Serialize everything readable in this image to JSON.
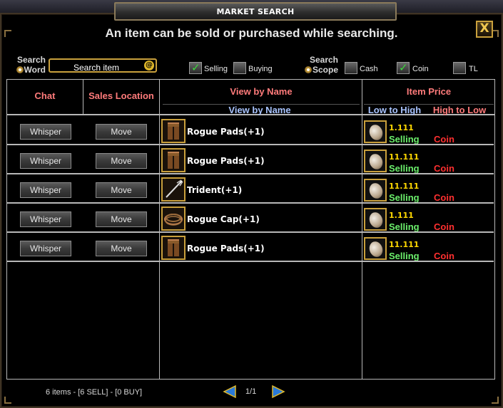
{
  "window": {
    "title": "MARKET SEARCH",
    "subtitle": "An item can be sold or purchased while searching.",
    "close_label": "X"
  },
  "search": {
    "word_label_1": "Search",
    "word_label_2": "Word",
    "placeholder": "Search item",
    "scope_label_1": "Search",
    "scope_label_2": "Scope"
  },
  "filters": {
    "selling": {
      "label": "Selling",
      "checked": true
    },
    "buying": {
      "label": "Buying",
      "checked": false
    },
    "cash": {
      "label": "Cash",
      "checked": false
    },
    "coin": {
      "label": "Coin",
      "checked": true
    },
    "tl": {
      "label": "TL",
      "checked": false
    }
  },
  "table": {
    "col_chat": "Chat",
    "col_sales_location": "Sales Location",
    "col_view_by_name": "View by Name",
    "col_view_by_name_sort": "View by Name",
    "col_item_price": "Item Price",
    "sort_low_high": "Low to High",
    "sort_high_low": "High to Low",
    "rows": [
      {
        "whisper": "Whisper",
        "move": "Move",
        "item": "Rogue Pads(+1)",
        "icon": "pads-icon",
        "price": "1.111",
        "status": "Selling",
        "currency": "Coin"
      },
      {
        "whisper": "Whisper",
        "move": "Move",
        "item": "Rogue Pads(+1)",
        "icon": "pads-icon",
        "price": "11.111",
        "status": "Selling",
        "currency": "Coin"
      },
      {
        "whisper": "Whisper",
        "move": "Move",
        "item": "Trident(+1)",
        "icon": "trident-icon",
        "price": "11.111",
        "status": "Selling",
        "currency": "Coin"
      },
      {
        "whisper": "Whisper",
        "move": "Move",
        "item": "Rogue Cap(+1)",
        "icon": "cap-icon",
        "price": "1.111",
        "status": "Selling",
        "currency": "Coin"
      },
      {
        "whisper": "Whisper",
        "move": "Move",
        "item": "Rogue Pads(+1)",
        "icon": "pads-icon",
        "price": "11.111",
        "status": "Selling",
        "currency": "Coin"
      }
    ]
  },
  "footer": {
    "summary": "6 items - [6 SELL] - [0 BUY]",
    "page": "1/1"
  },
  "colors": {
    "header_red": "#ff7b7b",
    "header_blue": "#a9c4ff",
    "price_yellow": "#ffd800",
    "selling_green": "#6cf06c",
    "coin_red": "#ff3030",
    "frame_gold": "#c9a03c"
  }
}
